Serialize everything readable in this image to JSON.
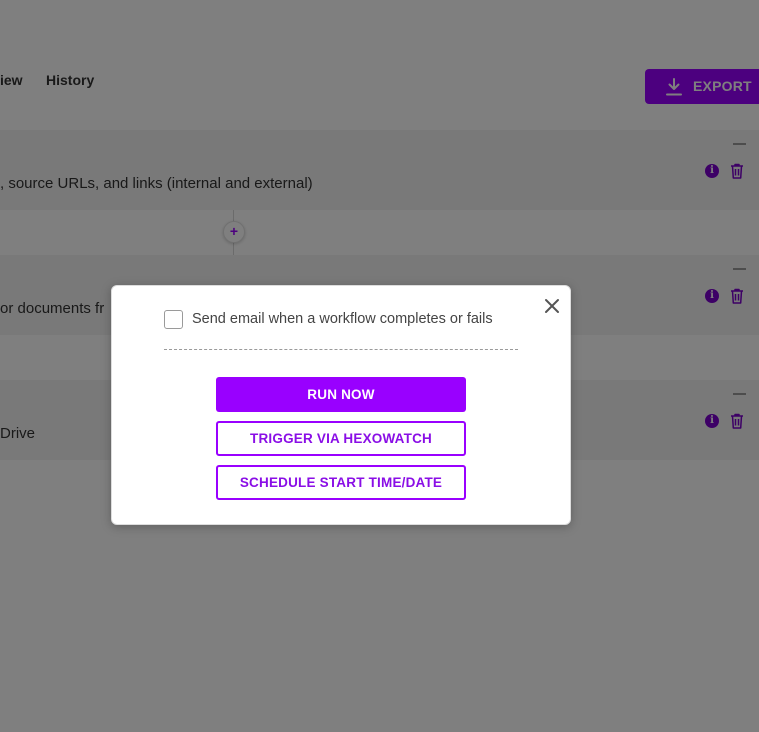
{
  "tabs": [
    {
      "label": "iew"
    },
    {
      "label": "History"
    }
  ],
  "export_button": {
    "label": "EXPORT",
    "icon": "download-icon"
  },
  "steps": [
    {
      "text": ", source URLs, and links (internal and external)"
    },
    {
      "text": "or documents fr"
    },
    {
      "text": "Drive"
    }
  ],
  "add_step": {
    "label": "+"
  },
  "modal": {
    "checkbox_label": "Send email when a workflow completes or fails",
    "checkbox_checked": false,
    "run_now_label": "RUN NOW",
    "trigger_label": "TRIGGER VIA HEXOWATCH",
    "schedule_label": "SCHEDULE START TIME/DATE",
    "close_icon": "close-icon"
  },
  "colors": {
    "accent": "#9900ff",
    "overlay": "rgba(0,0,0,0.5)",
    "step_background": "#f2f2f2"
  }
}
